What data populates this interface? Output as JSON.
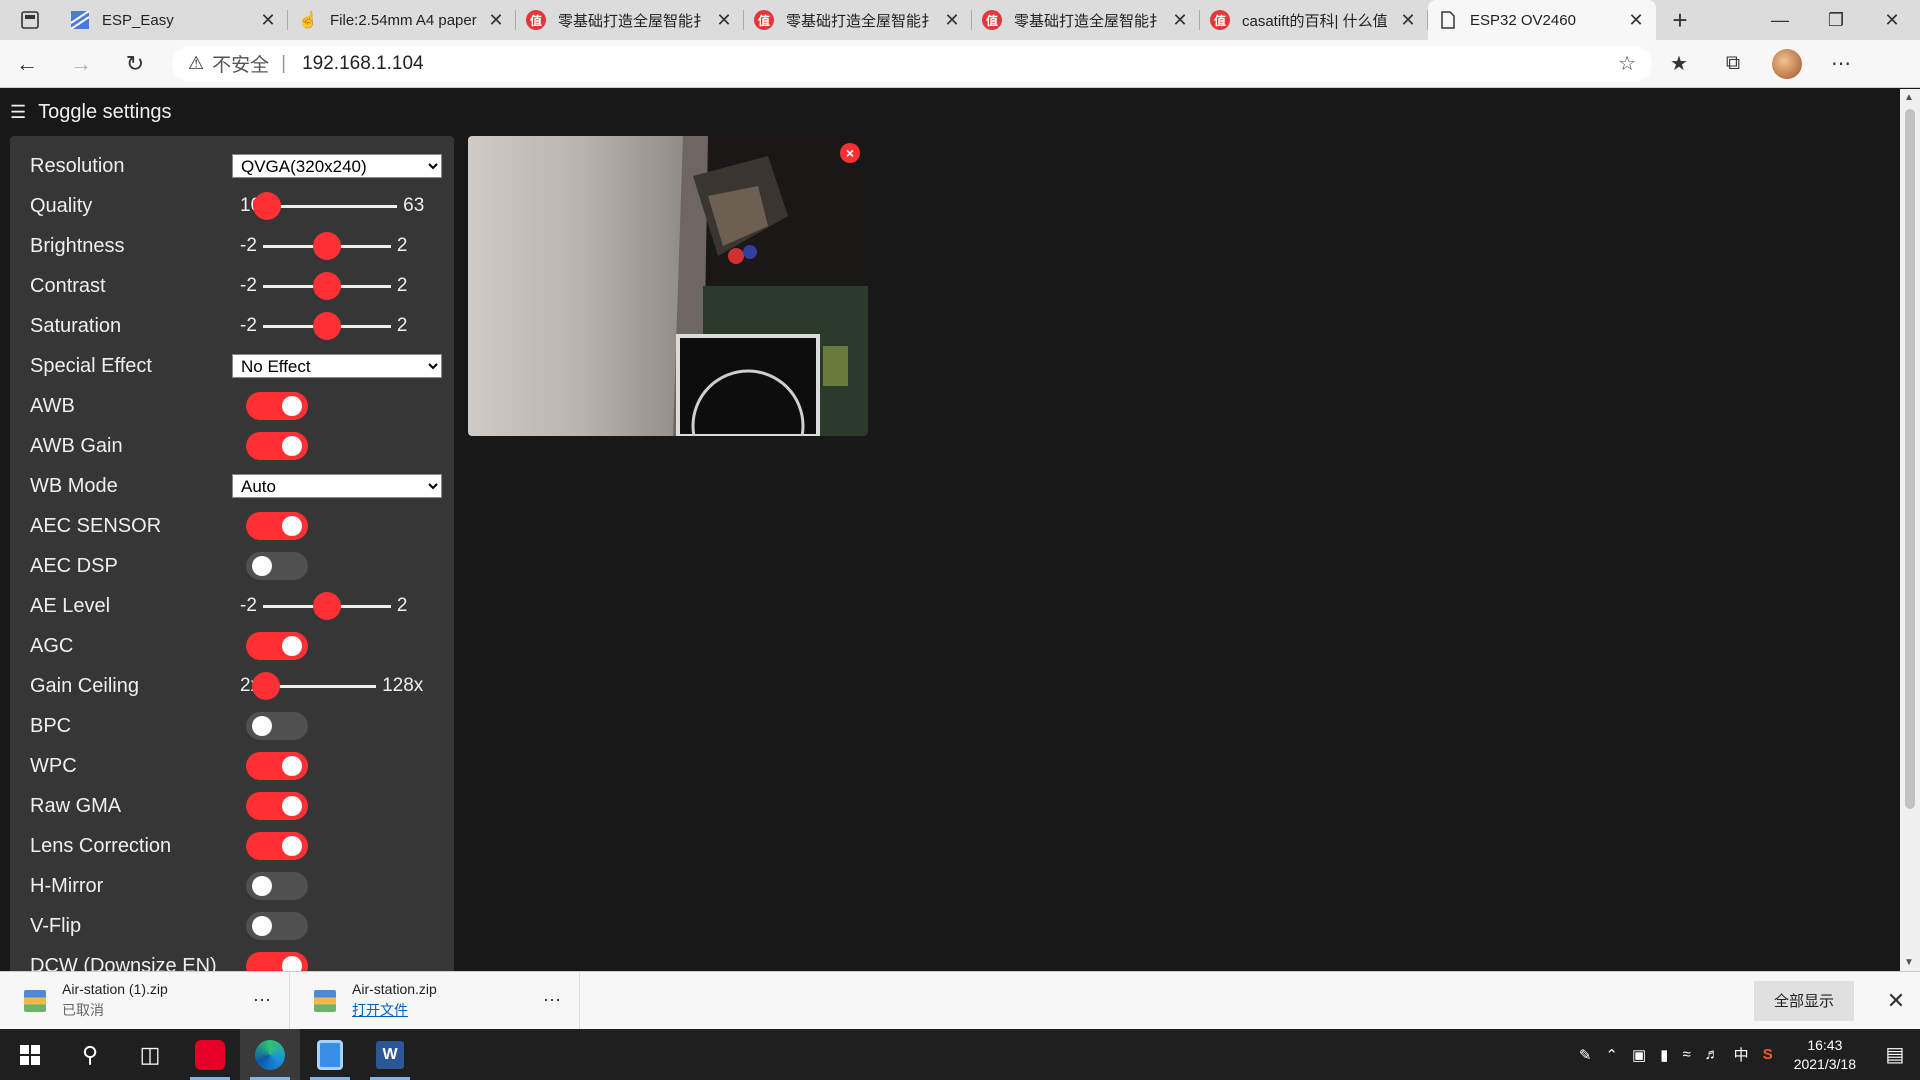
{
  "browser": {
    "tabs": [
      {
        "title": "ESP_Easy",
        "favicon": "wave-icon",
        "active": false
      },
      {
        "title": "File:2.54mm A4 paper",
        "favicon": "hand-icon",
        "active": false
      },
      {
        "title": "零基础打造全屋智能扌",
        "favicon": "smzdm-icon",
        "active": false
      },
      {
        "title": "零基础打造全屋智能扌",
        "favicon": "smzdm-icon",
        "active": false
      },
      {
        "title": "零基础打造全屋智能扌",
        "favicon": "smzdm-icon",
        "active": false
      },
      {
        "title": "casatift的百科| 什么值",
        "favicon": "smzdm-icon",
        "active": false
      },
      {
        "title": "ESP32 OV2460",
        "favicon": "page-icon",
        "active": true
      }
    ],
    "address": {
      "security_label": "不安全",
      "url": "192.168.1.104"
    }
  },
  "page": {
    "toggle_label": "Toggle settings",
    "controls": [
      {
        "id": "resolution",
        "label": "Resolution",
        "type": "select",
        "value": "QVGA(320x240)"
      },
      {
        "id": "quality",
        "label": "Quality",
        "type": "range",
        "min": "10",
        "max": "63",
        "value": 10,
        "lo": 10,
        "hi": 63
      },
      {
        "id": "brightness",
        "label": "Brightness",
        "type": "range",
        "min": "-2",
        "max": "2",
        "value": 0,
        "lo": -2,
        "hi": 2
      },
      {
        "id": "contrast",
        "label": "Contrast",
        "type": "range",
        "min": "-2",
        "max": "2",
        "value": 0,
        "lo": -2,
        "hi": 2
      },
      {
        "id": "saturation",
        "label": "Saturation",
        "type": "range",
        "min": "-2",
        "max": "2",
        "value": 0,
        "lo": -2,
        "hi": 2
      },
      {
        "id": "special-effect",
        "label": "Special Effect",
        "type": "select",
        "value": "No Effect"
      },
      {
        "id": "awb",
        "label": "AWB",
        "type": "switch",
        "on": true
      },
      {
        "id": "awb-gain",
        "label": "AWB Gain",
        "type": "switch",
        "on": true
      },
      {
        "id": "wb-mode",
        "label": "WB Mode",
        "type": "select",
        "value": "Auto"
      },
      {
        "id": "aec-sensor",
        "label": "AEC SENSOR",
        "type": "switch",
        "on": true
      },
      {
        "id": "aec-dsp",
        "label": "AEC DSP",
        "type": "switch",
        "on": false
      },
      {
        "id": "ae-level",
        "label": "AE Level",
        "type": "range",
        "min": "-2",
        "max": "2",
        "value": 0,
        "lo": -2,
        "hi": 2
      },
      {
        "id": "agc",
        "label": "AGC",
        "type": "switch",
        "on": true
      },
      {
        "id": "gain-ceiling",
        "label": "Gain Ceiling",
        "type": "range",
        "min": "2x",
        "max": "128x",
        "value": 0,
        "lo": 0,
        "hi": 6
      },
      {
        "id": "bpc",
        "label": "BPC",
        "type": "switch",
        "on": false
      },
      {
        "id": "wpc",
        "label": "WPC",
        "type": "switch",
        "on": true
      },
      {
        "id": "raw-gma",
        "label": "Raw GMA",
        "type": "switch",
        "on": true
      },
      {
        "id": "lens-correction",
        "label": "Lens Correction",
        "type": "switch",
        "on": true
      },
      {
        "id": "h-mirror",
        "label": "H-Mirror",
        "type": "switch",
        "on": false
      },
      {
        "id": "v-flip",
        "label": "V-Flip",
        "type": "switch",
        "on": false
      },
      {
        "id": "dcw",
        "label": "DCW (Downsize EN)",
        "type": "switch",
        "on": true
      }
    ],
    "stream_close": "×"
  },
  "downloads": {
    "items": [
      {
        "name": "Air-station (1).zip",
        "status": "已取消",
        "link": false
      },
      {
        "name": "Air-station.zip",
        "status": "打开文件",
        "link": true
      }
    ],
    "show_all": "全部显示"
  },
  "taskbar": {
    "time": "16:43",
    "date": "2021/3/18",
    "ime": "中"
  },
  "colors": {
    "accent": "#ff3034",
    "panel": "#363636",
    "background": "#181818"
  }
}
